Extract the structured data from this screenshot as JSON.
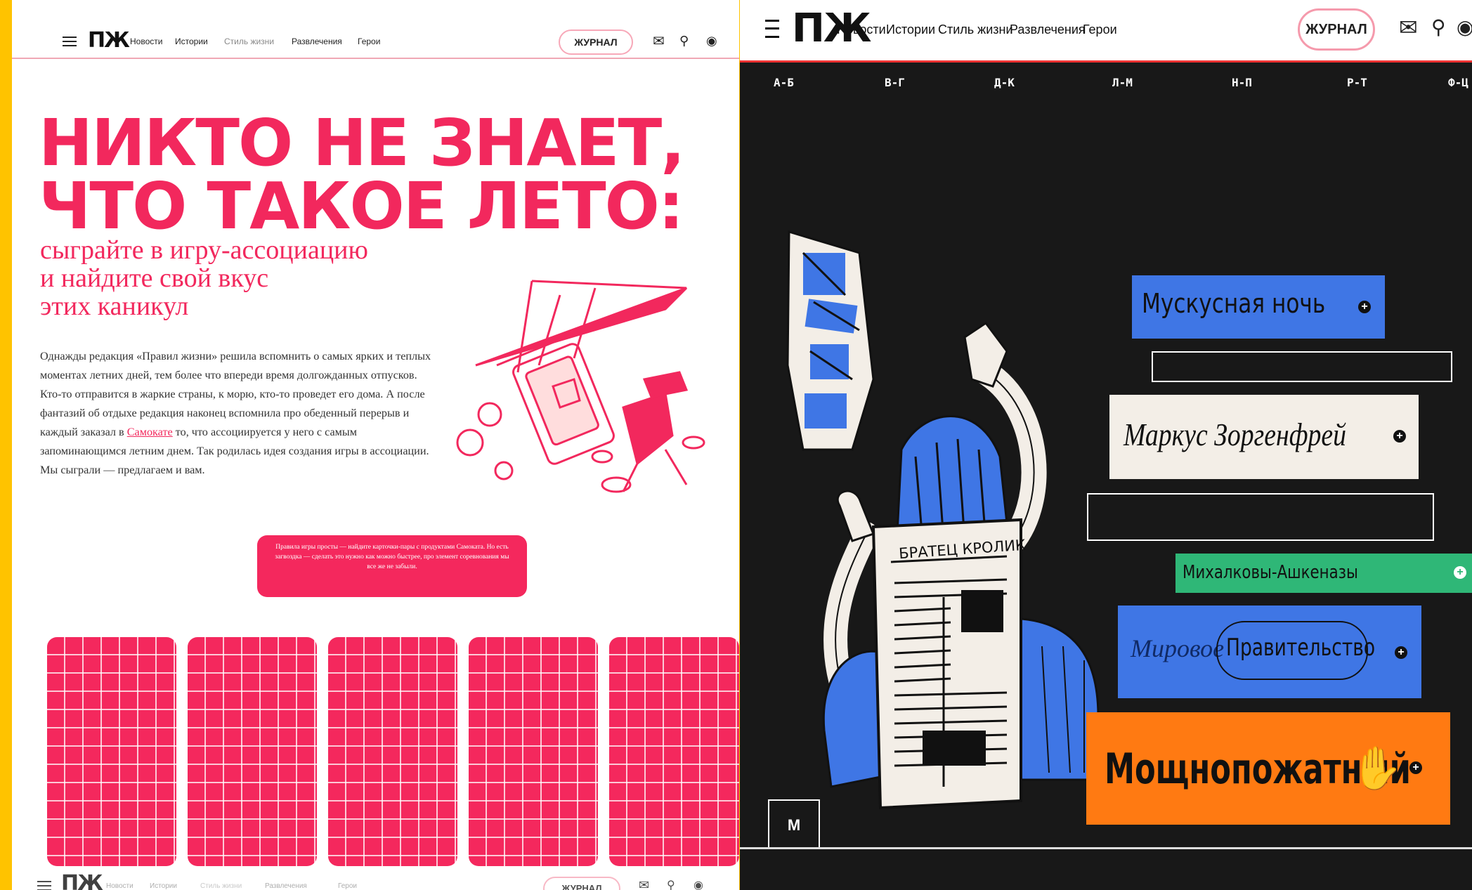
{
  "nav": {
    "logo": "ПЖ",
    "items": [
      "Новости",
      "Истории",
      "Стиль жизни",
      "Развлечения",
      "Герои"
    ],
    "journal_button": "ЖУРНАЛ"
  },
  "left": {
    "headline_line1": "НИКТО НЕ ЗНАЕТ,",
    "headline_line2": "ЧТО ТАКОЕ ЛЕТО:",
    "subheading": [
      "сыграйте в игру-ассоциацию",
      "и найдите свой вкус",
      "этих каникул"
    ],
    "intro_before_link": "Однажды редакция «Правил жизни» решила вспомнить о самых ярких и теплых моментах летних дней, тем более что впереди время долгожданных отпусков. Кто-то отправится в жаркие страны, к морю, кто-то проведет его дома. А после фантазий об отдыхе редакция наконец вспомнила про обеденный перерыв и каждый заказал в",
    "intro_link": "Самокате",
    "intro_after_link": "то, что ассоциируется у него с самым запоминающимся летним днем. Так родилась идея создания игры в ассоциации. Мы сыграли — предлагаем и вам.",
    "rules_text": "Правила игры просты — найдите карточки-пары с продуктами Самоката. Но есть загвоздка — сделать это нужно как можно быстрее, про элемент соревнования мы все же не забыли.",
    "card_count": 5
  },
  "right": {
    "alphabet": [
      "А-Б",
      "В-Г",
      "Д-К",
      "Л-М",
      "Н-П",
      "Р-Т",
      "Ф-Ц"
    ],
    "newspaper_title": "БРАТЕЦ КРОЛИК",
    "entries": {
      "muskus": "Мускусная ночь",
      "markus": "Маркус Зоргенфрей",
      "mikhalkovy": "Михалковы-Ашкеназы",
      "mirovoe": "Мировое",
      "pravitelstvo": "Правительство",
      "moshno": "Мощнопожатный"
    },
    "letter_badge": "М",
    "colors": {
      "blue": "#3f76e5",
      "cream": "#f3eee7",
      "green": "#2fb777",
      "orange": "#ff7a12"
    }
  },
  "colors": {
    "accent_pink": "#f2285d",
    "frame_yellow": "#FFC300"
  }
}
